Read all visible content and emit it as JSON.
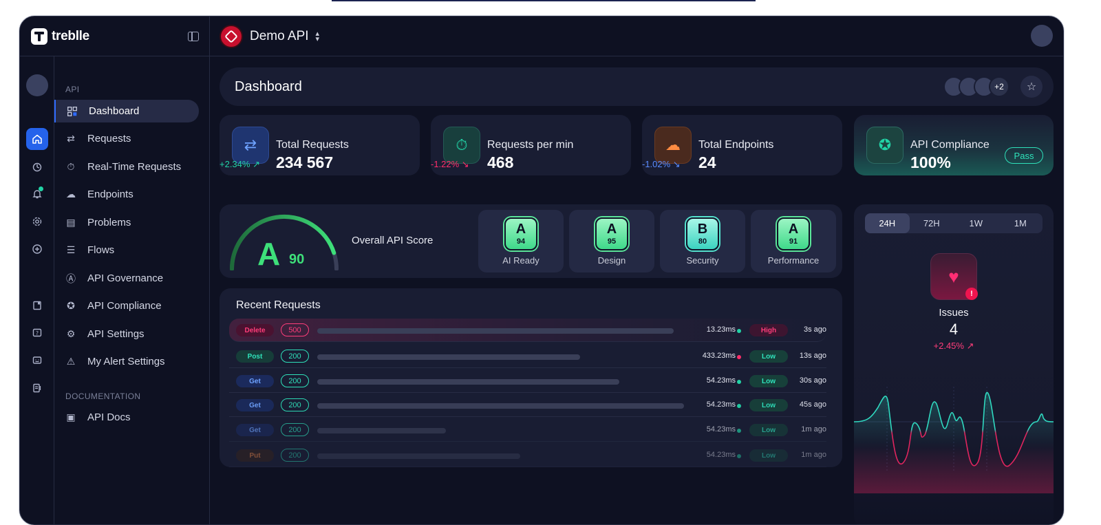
{
  "app": {
    "brand": "treblle",
    "project": "Demo API"
  },
  "sidebar": {
    "section_api": "API",
    "items": [
      {
        "label": "Dashboard",
        "icon": "grid-icon"
      },
      {
        "label": "Requests",
        "icon": "arrows-swap-icon"
      },
      {
        "label": "Real-Time Requests",
        "icon": "stopwatch-icon"
      },
      {
        "label": "Endpoints",
        "icon": "endpoints-icon"
      },
      {
        "label": "Problems",
        "icon": "list-icon"
      },
      {
        "label": "Flows",
        "icon": "stack-icon"
      },
      {
        "label": "API Governance",
        "icon": "governance-icon"
      },
      {
        "label": "API Compliance",
        "icon": "award-icon"
      },
      {
        "label": "API Settings",
        "icon": "gear-icon"
      },
      {
        "label": "My Alert Settings",
        "icon": "warning-icon"
      }
    ],
    "section_docs": "DOCUMENTATION",
    "docs_item": "API Docs"
  },
  "header": {
    "title": "Dashboard",
    "avatars_more": "+2"
  },
  "stats": [
    {
      "label": "Total Requests",
      "value": "234 567",
      "change": "+2.34% ↗",
      "color": "#22d3a6"
    },
    {
      "label": "Requests per min",
      "value": "468",
      "change": "-1.22% ↘",
      "color": "#ff2e6a"
    },
    {
      "label": "Total Endpoints",
      "value": "24",
      "change": "-1.02% ↘",
      "color": "#5b8cff"
    }
  ],
  "compliance": {
    "label": "API Compliance",
    "value": "100%",
    "status": "Pass"
  },
  "score": {
    "grade": "A",
    "value": "90",
    "label": "Overall API Score",
    "gauge_fraction": 0.9,
    "categories": [
      {
        "grade": "A",
        "score": "94",
        "label": "AI Ready"
      },
      {
        "grade": "A",
        "score": "95",
        "label": "Design"
      },
      {
        "grade": "B",
        "score": "80",
        "label": "Security"
      },
      {
        "grade": "A",
        "score": "91",
        "label": "Performance"
      }
    ]
  },
  "recent": {
    "title": "Recent Requests",
    "rows": [
      {
        "method": "Delete",
        "code": "500",
        "ms": "13.23ms",
        "severity": "High",
        "ago": "3s ago",
        "bar_fraction": 0.72
      },
      {
        "method": "Post",
        "code": "200",
        "ms": "433.23ms",
        "severity": "Low",
        "ago": "13s ago",
        "bar_fraction": 0.53
      },
      {
        "method": "Get",
        "code": "200",
        "ms": "54.23ms",
        "severity": "Low",
        "ago": "30s ago",
        "bar_fraction": 0.61
      },
      {
        "method": "Get",
        "code": "200",
        "ms": "54.23ms",
        "severity": "Low",
        "ago": "45s ago",
        "bar_fraction": 0.74
      },
      {
        "method": "Get",
        "code": "200",
        "ms": "54.23ms",
        "severity": "Low",
        "ago": "1m ago",
        "bar_fraction": 0.26
      },
      {
        "method": "Put",
        "code": "200",
        "ms": "54.23ms",
        "severity": "Low",
        "ago": "1m ago",
        "bar_fraction": 0.41
      }
    ]
  },
  "issues": {
    "tabs": [
      "24H",
      "72H",
      "1W",
      "1M"
    ],
    "active_tab": "24H",
    "label": "Issues",
    "count": "4",
    "change": "+2.45% ↗"
  }
}
